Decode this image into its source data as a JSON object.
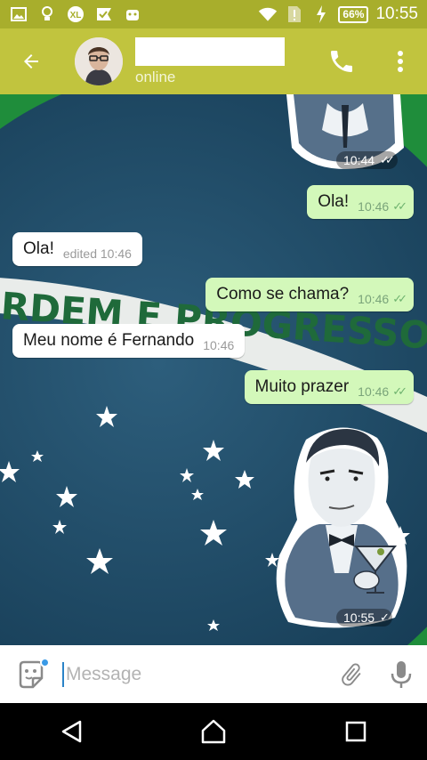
{
  "status_bar": {
    "battery": "66%",
    "time": "10:55"
  },
  "header": {
    "contact_status": "online"
  },
  "messages": [
    {
      "direction": "out",
      "type": "sticker",
      "time": "10:44",
      "ticks": "✓✓"
    },
    {
      "direction": "out",
      "text": "Ola!",
      "time": "10:46",
      "ticks": "✓✓"
    },
    {
      "direction": "in",
      "text": "Ola!",
      "time": "edited 10:46"
    },
    {
      "direction": "out",
      "text": "Como se chama?",
      "time": "10:46",
      "ticks": "✓✓"
    },
    {
      "direction": "in",
      "text": "Meu nome é Fernando",
      "time": "10:46"
    },
    {
      "direction": "out",
      "text": "Muito prazer",
      "time": "10:46",
      "ticks": "✓✓"
    },
    {
      "direction": "out",
      "type": "sticker",
      "time": "10:55",
      "ticks": "✓"
    }
  ],
  "background": {
    "banner_text": "RDEM E PROGRESSO"
  },
  "input": {
    "placeholder": "Message"
  },
  "colors": {
    "accent": "#c1c43e",
    "status_bar": "#a8ae2c",
    "outgoing_bubble": "#d3f8ba",
    "incoming_bubble": "#ffffff"
  },
  "icons": [
    "back-arrow-icon",
    "phone-icon",
    "more-vert-icon",
    "sticker-icon",
    "paperclip-icon",
    "microphone-icon",
    "nav-back-icon",
    "nav-home-icon",
    "nav-recents-icon"
  ]
}
